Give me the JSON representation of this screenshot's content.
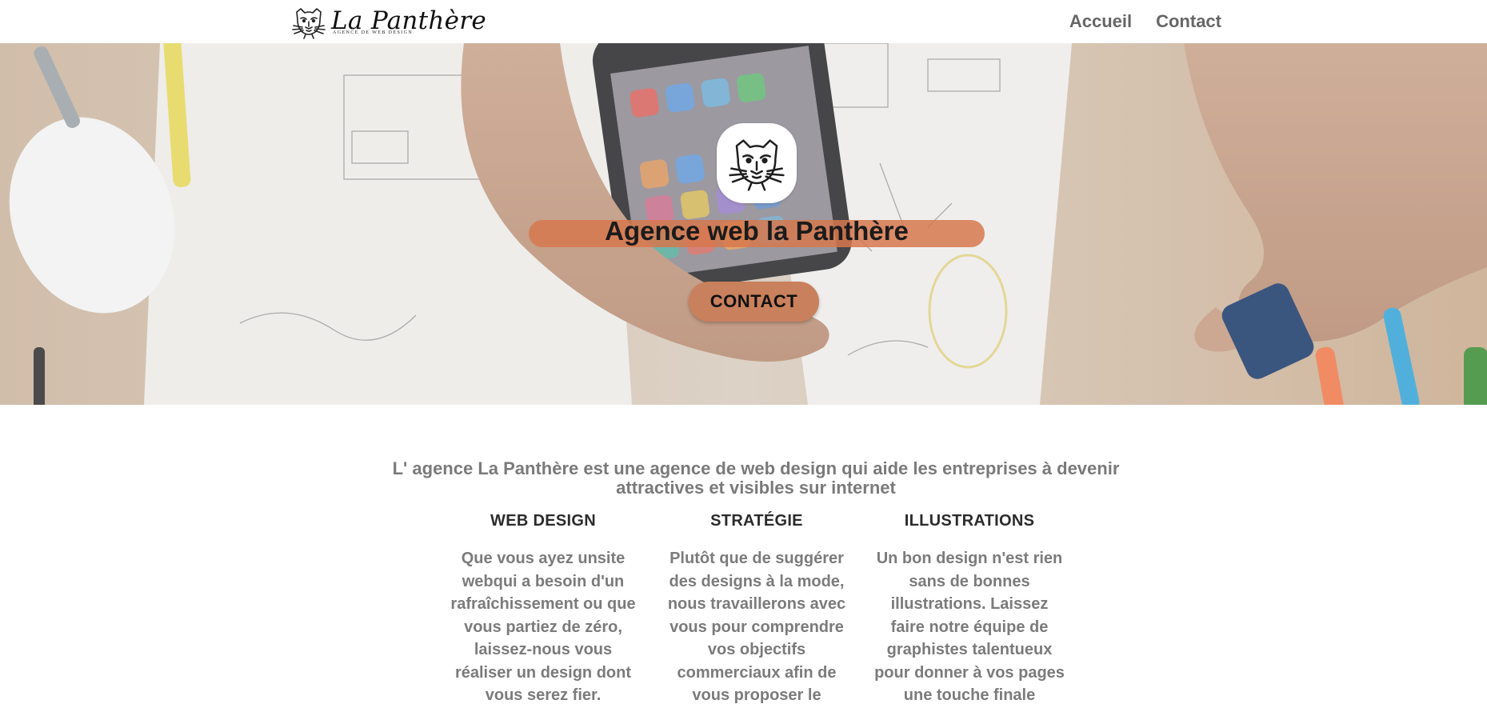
{
  "header": {
    "logo_title": "La Panthère",
    "logo_tagline": "AGENCE DE WEB DESIGN",
    "nav": [
      {
        "label": "Accueil"
      },
      {
        "label": "Contact"
      }
    ]
  },
  "hero": {
    "title": "Agence web la Panthère",
    "cta_label": "CONTACT",
    "accent_color": "#c9805c"
  },
  "intro": {
    "text": "L' agence La Panthère est une agence de web design qui aide les entreprises à devenir attractives et visibles sur internet"
  },
  "services": [
    {
      "title": "WEB DESIGN",
      "text": "Que vous ayez unsite webqui a besoin d'un rafraîchissement ou que vous partiez de zéro, laissez-nous vous réaliser un design dont vous serez fier."
    },
    {
      "title": "STRATÉGIE",
      "text": "Plutôt que de suggérer des designs à la mode, nous travaillerons avec vous pour comprendre vos objectifs commerciaux afin de vous proposer le"
    },
    {
      "title": "ILLUSTRATIONS",
      "text": "Un bon design n'est rien sans de bonnes illustrations. Laissez faire notre équipe de graphistes talentueux pour donner à vos pages une touche finale"
    }
  ],
  "icons": {
    "logo": "panther-head-icon",
    "badge": "panther-head-icon"
  }
}
